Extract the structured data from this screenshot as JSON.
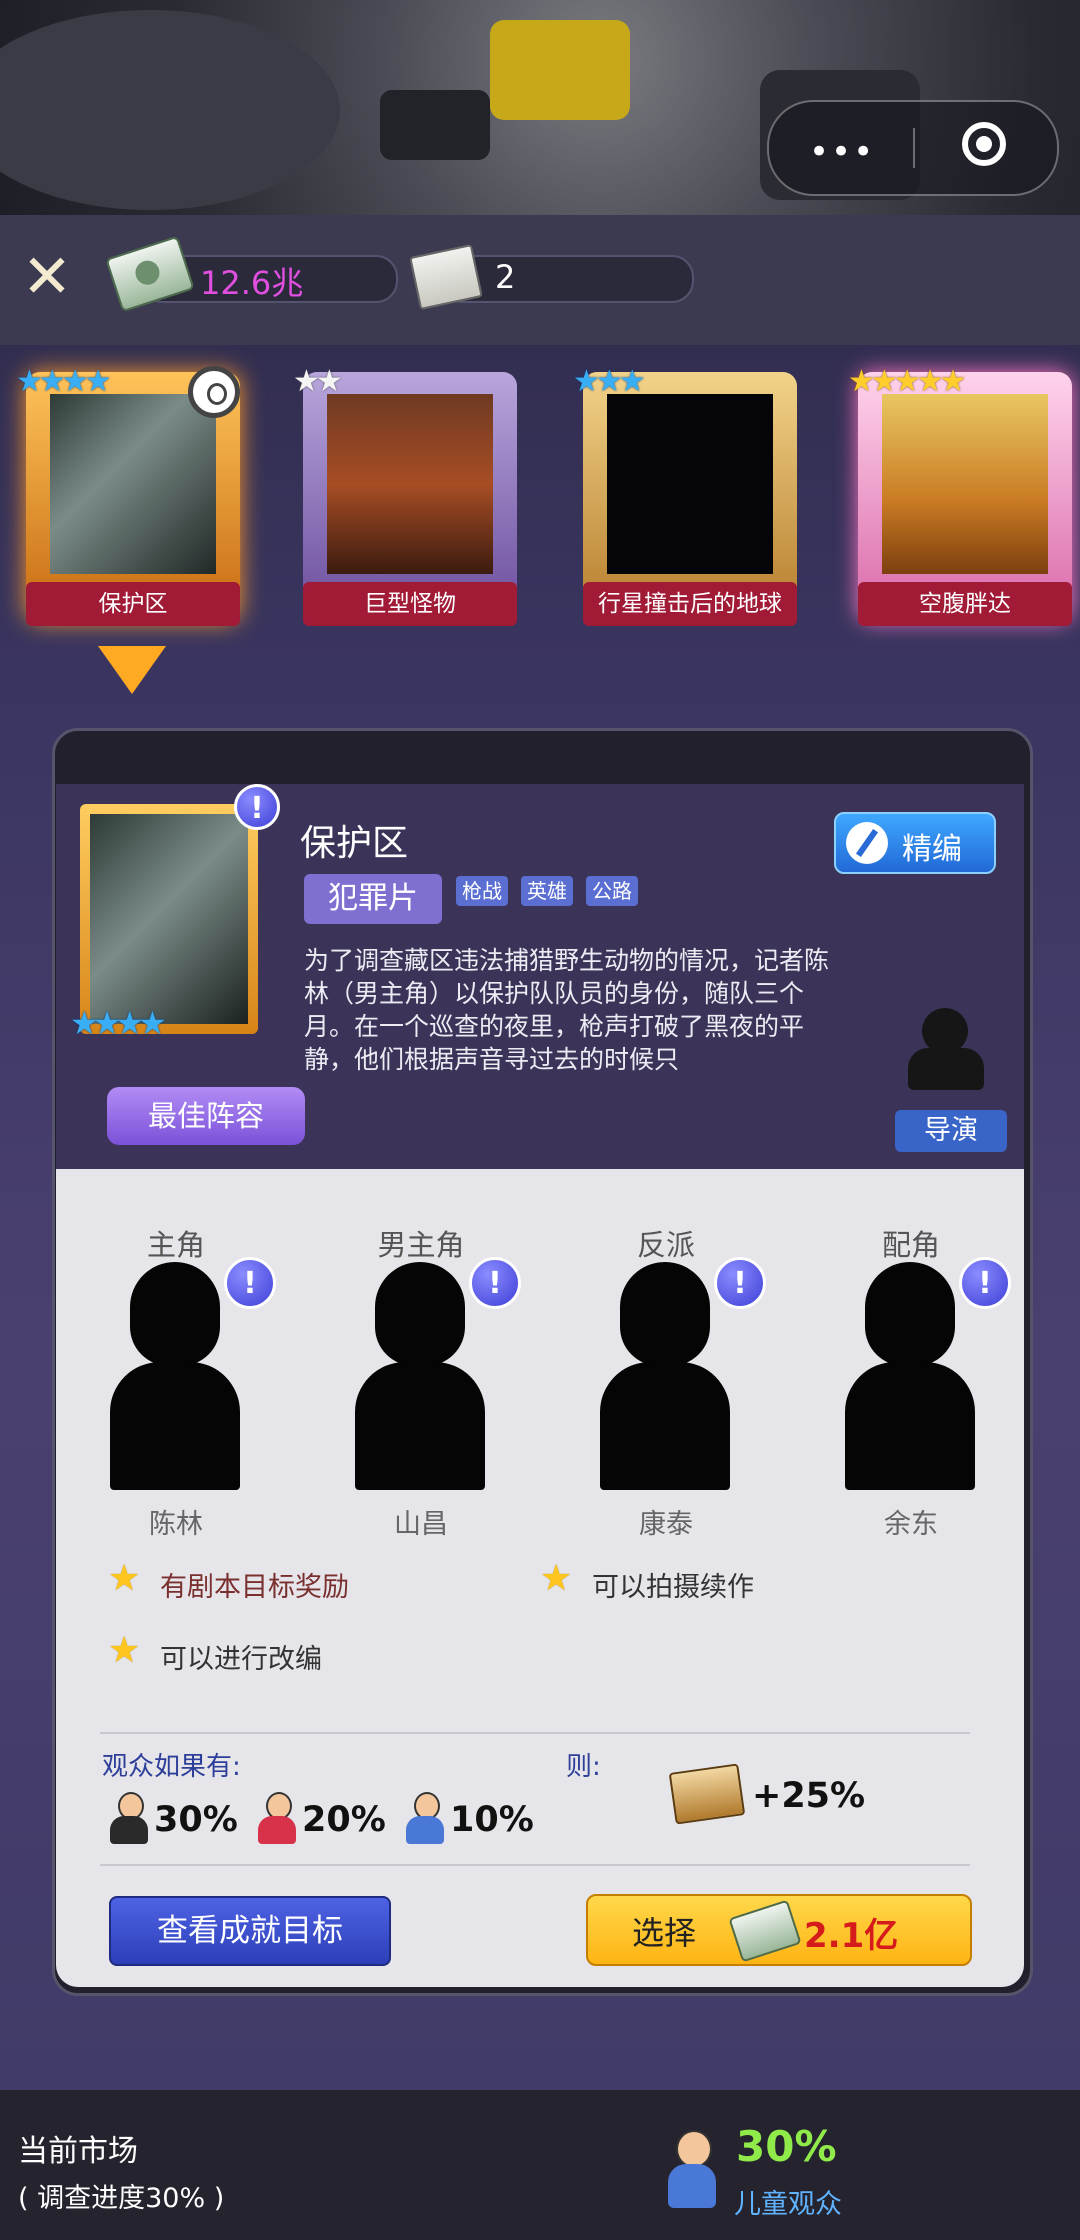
{
  "resources": {
    "money": "12.6兆",
    "tickets": "2"
  },
  "scripts": [
    {
      "title": "保护区",
      "stars": "★★★★"
    },
    {
      "title": "巨型怪物",
      "stars": "★★"
    },
    {
      "title": "行星撞击后的地球",
      "stars": "★★★"
    },
    {
      "title": "空腹胖达",
      "stars": "★★★★★"
    }
  ],
  "detail": {
    "title": "保护区",
    "genre": "犯罪片",
    "tags": [
      "枪战",
      "英雄",
      "公路"
    ],
    "edit_label": "精编",
    "poster_stars": "★★★★",
    "synopsis": "为了调查藏区违法捕猎野生动物的情况，记者陈林（男主角）以保护队队员的身份，随队三个月。在一个巡查的夜里，枪声打破了黑夜的平静，他们根据声音寻过去的时候只",
    "best_cast_label": "最佳阵容",
    "director_label": "导演"
  },
  "cast": [
    {
      "role": "主角",
      "actor": "陈林"
    },
    {
      "role": "男主角",
      "actor": "山昌"
    },
    {
      "role": "反派",
      "actor": "康泰"
    },
    {
      "role": "配角",
      "actor": "余东"
    }
  ],
  "features": [
    "有剧本目标奖励",
    "可以拍摄续作",
    "可以进行改编"
  ],
  "audience": {
    "if_label": "观众如果有:",
    "then_label": "则:",
    "male_pct": "30%",
    "female_pct": "20%",
    "child_pct": "10%",
    "bonus": "+25%"
  },
  "actions": {
    "goals_label": "查看成就目标",
    "select_label": "选择",
    "cost": "2.1亿"
  },
  "market": {
    "title": "当前市场",
    "progress": "( 调查进度30% )",
    "pct": "30%",
    "audience_label": "儿童观众"
  }
}
